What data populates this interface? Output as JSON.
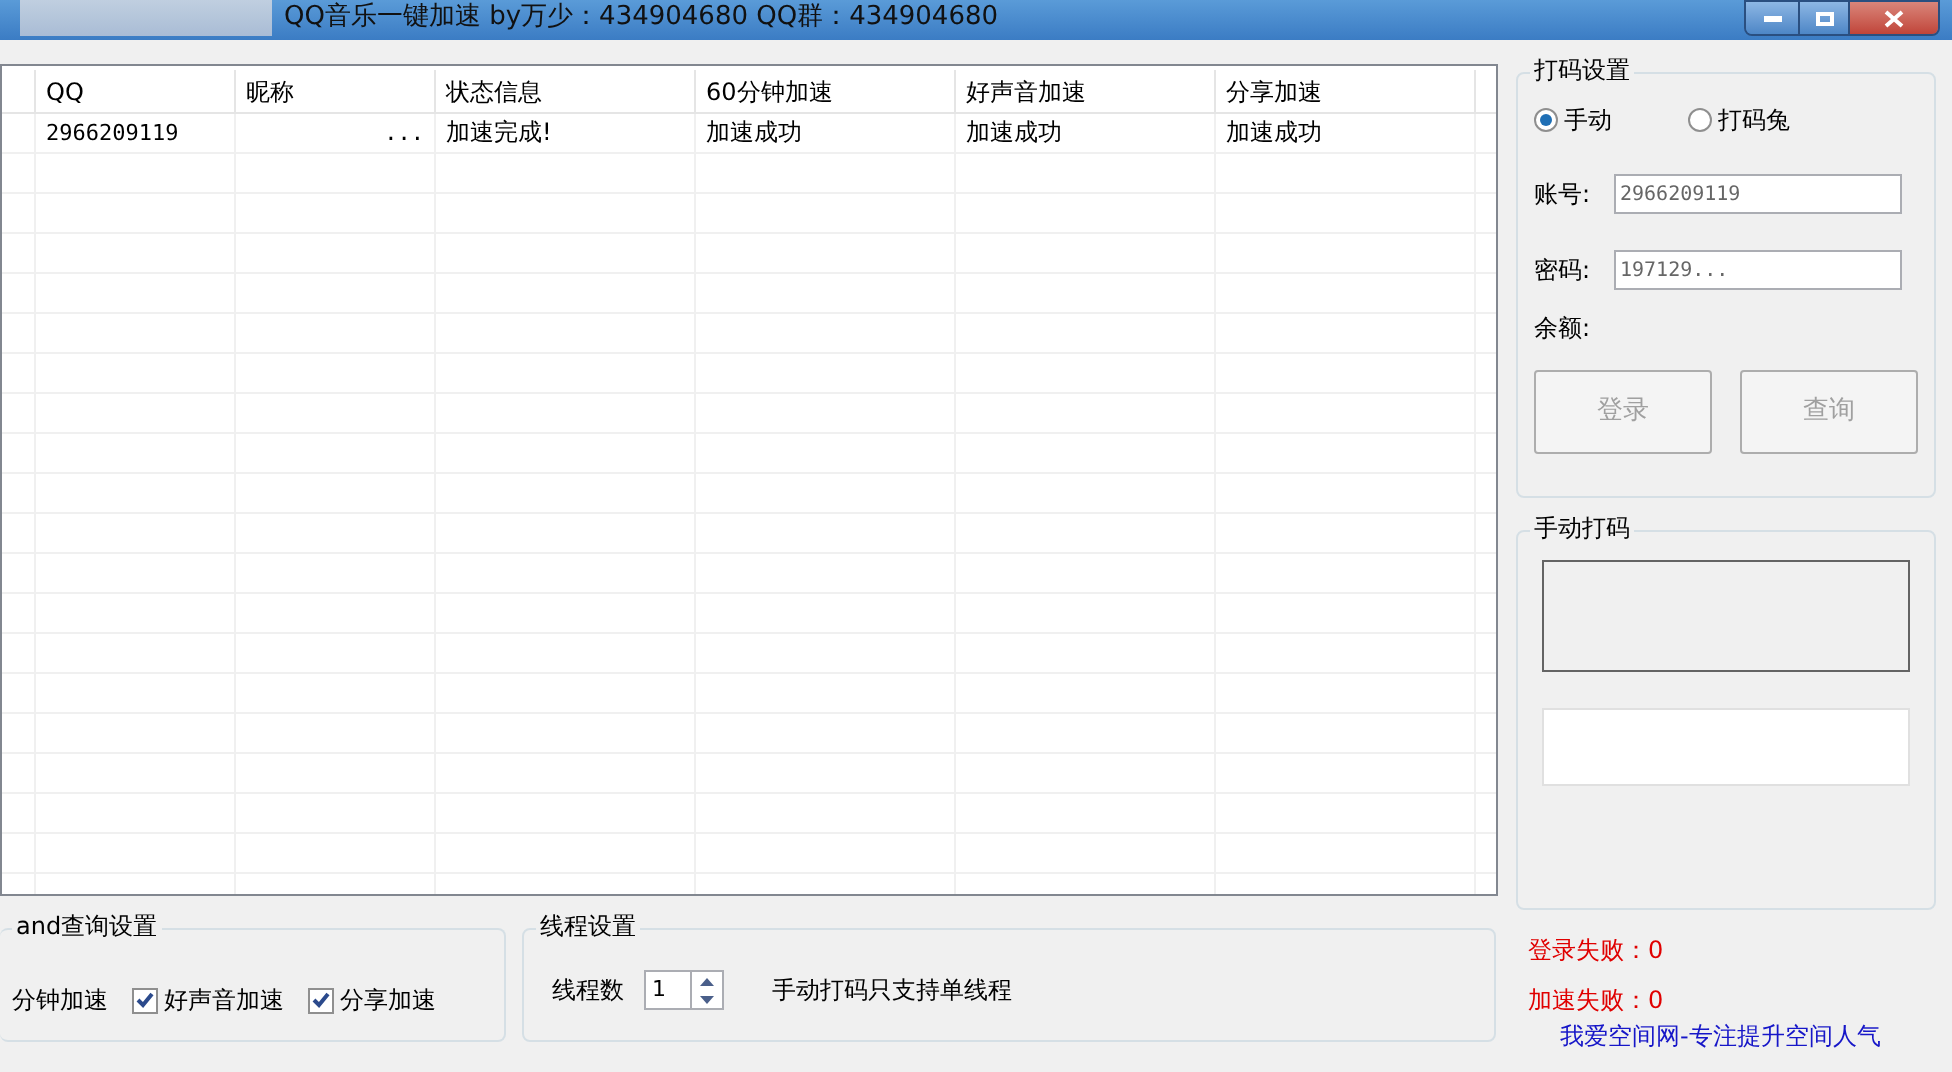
{
  "window": {
    "title": "QQ音乐一键加速  by万少：434904680  QQ群：434904680"
  },
  "table": {
    "columns": [
      "QQ",
      "昵称",
      "状态信息",
      "60分钟加速",
      "好声音加速",
      "分享加速"
    ],
    "rows": [
      [
        "2966209119",
        "...",
        "加速完成!",
        "加速成功",
        "加速成功",
        "加速成功"
      ]
    ]
  },
  "captcha_settings": {
    "title": "打码设置",
    "modes": [
      {
        "label": "手动",
        "selected": true
      },
      {
        "label": "打码兔",
        "selected": false
      }
    ],
    "account_label": "账号:",
    "account": "2966209119",
    "password_label": "密码:",
    "password": "197129...",
    "balance_label": "余额:",
    "buttons": [
      {
        "label": "登录",
        "disabled": true
      },
      {
        "label": "查询",
        "disabled": true
      }
    ]
  },
  "manual_captcha": {
    "title": "手动打码"
  },
  "query_settings": {
    "title": "and查询设置",
    "options": [
      {
        "kind": "text",
        "label": "分钟加速"
      },
      {
        "kind": "checkbox",
        "label": "好声音加速",
        "checked": true
      },
      {
        "kind": "checkbox",
        "label": "分享加速",
        "checked": true
      }
    ]
  },
  "thread_settings": {
    "title": "线程设置",
    "label": "线程数",
    "value": "1",
    "note": "手动打码只支持单线程"
  },
  "stats": [
    "登录失败：0",
    "加速失败：0"
  ],
  "link": "我爱空间网-专注提升空间人气"
}
